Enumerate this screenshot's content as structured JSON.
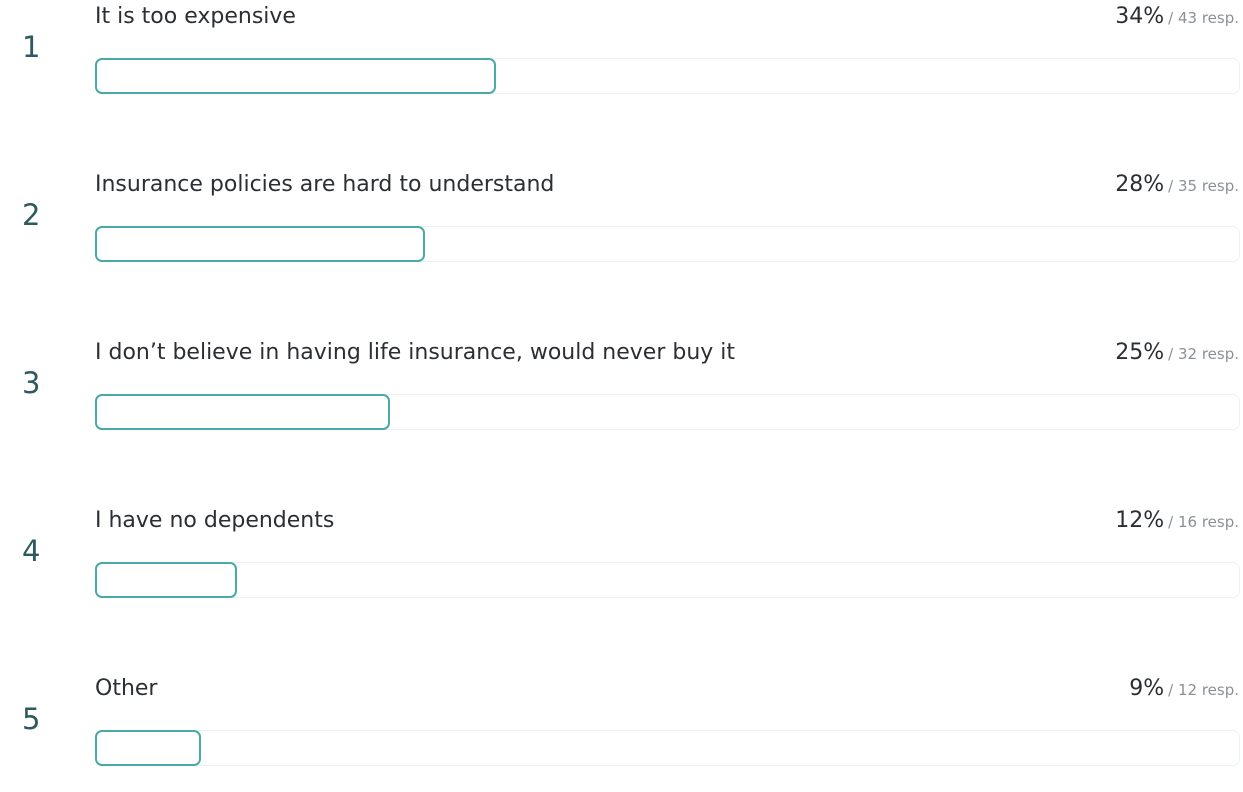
{
  "chart_data": {
    "type": "bar",
    "orientation": "horizontal",
    "max_value": 34,
    "bars": [
      {
        "rank": "1",
        "label": "It is too expensive",
        "value": 34,
        "percent_text": "34%",
        "responses_text": "/ 43 resp."
      },
      {
        "rank": "2",
        "label": "Insurance policies are hard to understand",
        "value": 28,
        "percent_text": "28%",
        "responses_text": "/ 35 resp."
      },
      {
        "rank": "3",
        "label": "I don’t believe in having life insurance, would never buy it",
        "value": 25,
        "percent_text": "25%",
        "responses_text": "/ 32 resp."
      },
      {
        "rank": "4",
        "label": "I have no dependents",
        "value": 12,
        "percent_text": "12%",
        "responses_text": "/ 16 resp."
      },
      {
        "rank": "5",
        "label": "Other",
        "value": 9,
        "percent_text": "9%",
        "responses_text": "/ 12 resp."
      }
    ],
    "colors": {
      "bar_stroke": "#4aaaa7",
      "track_stroke": "#e8f2f2",
      "rank_text": "#2e5a5e",
      "label_text": "#2b2f33",
      "resp_text": "#8a9196"
    }
  }
}
